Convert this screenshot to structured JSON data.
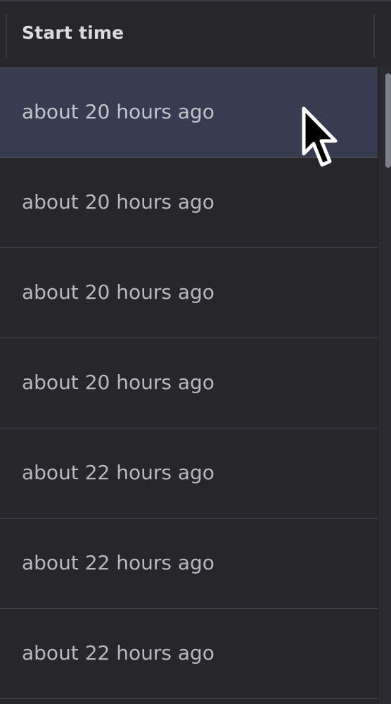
{
  "table": {
    "column_header": "Start time",
    "rows": [
      {
        "start_time": "about 20 hours ago"
      },
      {
        "start_time": "about 20 hours ago"
      },
      {
        "start_time": "about 20 hours ago"
      },
      {
        "start_time": "about 20 hours ago"
      },
      {
        "start_time": "about 22 hours ago"
      },
      {
        "start_time": "about 22 hours ago"
      },
      {
        "start_time": "about 22 hours ago"
      }
    ]
  },
  "icons": {
    "pointer": "mouse-pointer-icon"
  },
  "colors": {
    "background": "#26262b",
    "selected_row": "#383c50",
    "row_text": "#b8b8bf",
    "header_text": "#d9d9de"
  }
}
